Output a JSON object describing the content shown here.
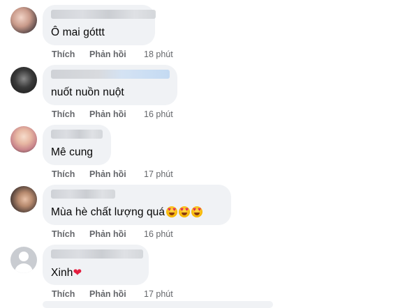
{
  "comments": [
    {
      "text": "Ô mai góttt",
      "like_label": "Thích",
      "reply_label": "Phản hồi",
      "time": "18 phút"
    },
    {
      "text": "nuốt nuồn nuột",
      "like_label": "Thích",
      "reply_label": "Phản hồi",
      "time": "16 phút"
    },
    {
      "text": "Mê cung",
      "like_label": "Thích",
      "reply_label": "Phản hồi",
      "time": "17 phút"
    },
    {
      "text": "Mùa hè chất lượng quá",
      "like_label": "Thích",
      "reply_label": "Phản hồi",
      "time": "16 phút"
    },
    {
      "text": "Xinh",
      "like_label": "Thích",
      "reply_label": "Phản hồi",
      "time": "17 phút"
    }
  ],
  "colors": {
    "bubble": "#f0f2f5",
    "meta_text": "#65676b",
    "body_text": "#050505",
    "heart": "#e41e3f"
  },
  "icons": [
    "heart-eyes-emoji-icon",
    "red-heart-icon",
    "default-avatar-icon"
  ]
}
